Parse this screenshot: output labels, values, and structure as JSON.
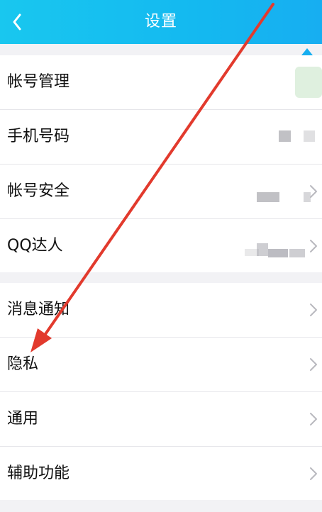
{
  "header": {
    "title": "设置"
  },
  "groups": [
    {
      "items": [
        {
          "label": "帐号管理"
        },
        {
          "label": "手机号码"
        },
        {
          "label": "帐号安全"
        },
        {
          "label": "QQ达人"
        }
      ]
    },
    {
      "items": [
        {
          "label": "消息通知"
        },
        {
          "label": "隐私"
        },
        {
          "label": "通用"
        },
        {
          "label": "辅助功能"
        }
      ]
    }
  ],
  "icons": {
    "back": "chevron-left-icon",
    "row_arrow": "chevron-right-icon",
    "annotation": "red-arrow-icon"
  },
  "colors": {
    "header_start": "#19c7ef",
    "header_end": "#17aef1",
    "annotation": "#e23a2d"
  }
}
